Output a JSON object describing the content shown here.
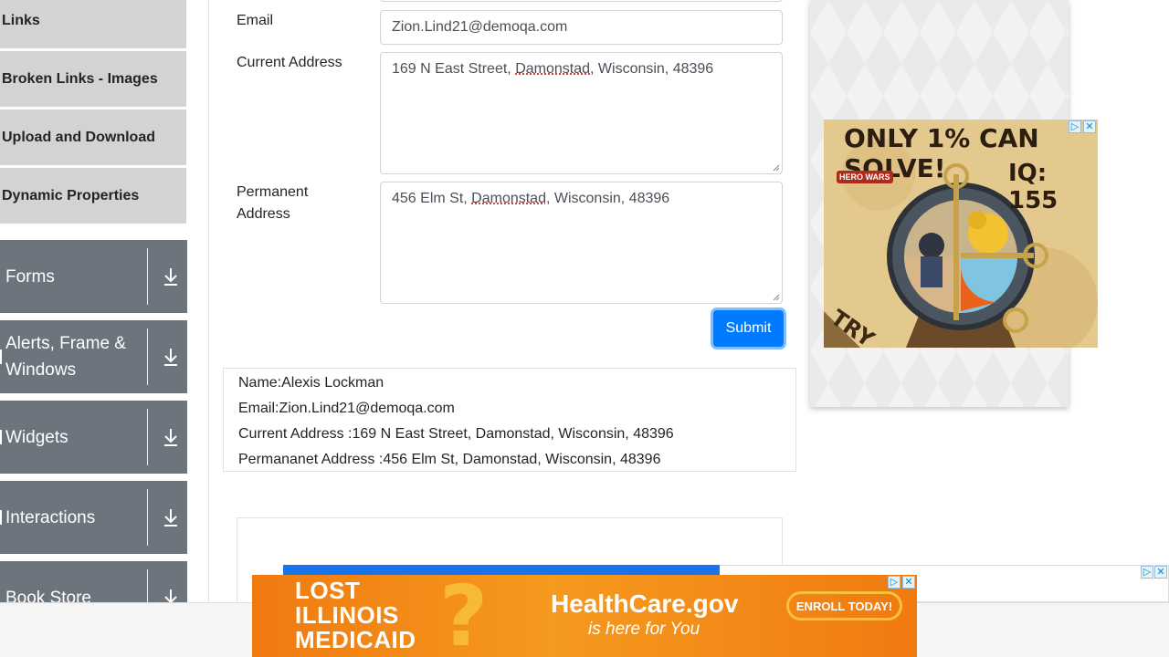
{
  "sidebar": {
    "items": [
      {
        "label": "Links"
      },
      {
        "label": "Broken Links - Images"
      },
      {
        "label": "Upload and Download"
      },
      {
        "label": "Dynamic Properties"
      }
    ],
    "groups": [
      {
        "label": "Forms"
      },
      {
        "label": "Alerts, Frame & Windows"
      },
      {
        "label": "Widgets"
      },
      {
        "label": "Interactions"
      },
      {
        "label": "Book Store"
      }
    ]
  },
  "form": {
    "email_label": "Email",
    "email_value": "Zion.Lind21@demoqa.com",
    "current_address_label": "Current Address",
    "current_address_parts": [
      "169 N East Street, ",
      "Damonstad",
      ", Wisconsin, 48396"
    ],
    "permanent_address_label": "Permanent Address",
    "permanent_address_parts": [
      "456 Elm St, ",
      "Damonstad",
      ", Wisconsin, 48396"
    ],
    "submit_label": "Submit"
  },
  "output": {
    "name": "Name:Alexis Lockman",
    "email": "Email:Zion.Lind21@demoqa.com",
    "current_address": "Current Address :169 N East Street, Damonstad, Wisconsin, 48396",
    "permanent_address": "Permananet Address :456 Elm St, Damonstad, Wisconsin, 48396"
  },
  "ads": {
    "game": {
      "headline": "ONLY 1% CAN SOLVE!",
      "iq": "IQ: 155",
      "brand": "HERO WARS",
      "cta": "TRY"
    },
    "healthcare": {
      "line1": "LOST",
      "line2": "ILLINOIS",
      "line3": "MEDICAID",
      "brand": "HealthCare.gov",
      "tagline": "is here for You",
      "cta": "ENROLL TODAY!"
    },
    "adchoices_icon": "ad-choices-icon",
    "close_icon": "close-icon"
  },
  "colors": {
    "primary": "#007bff",
    "sidebar_group": "#6c757d",
    "sidebar_item": "#d3d3d3",
    "ad_orange": "#f07a10"
  }
}
